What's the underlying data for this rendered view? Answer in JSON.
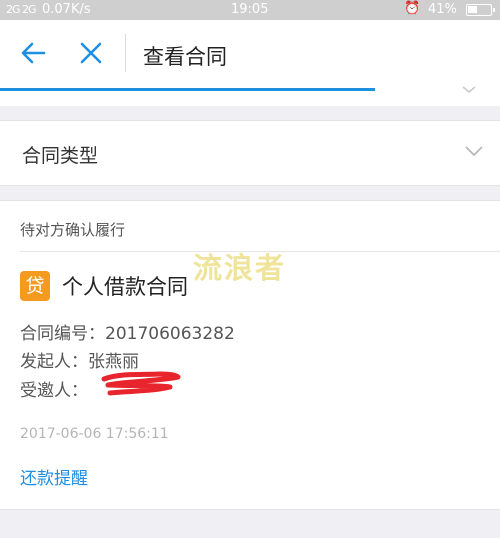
{
  "status_bar": {
    "signal": "2G 2G",
    "speed": "0.07K/s",
    "time": "19:05",
    "battery": "41%",
    "battery_level": 0.41
  },
  "nav": {
    "title": "查看合同"
  },
  "page_progress": 0.75,
  "contract_type": {
    "label": "合同类型"
  },
  "contract": {
    "status": "待对方确认履行",
    "watermark": "流浪者",
    "icon_char": "贷",
    "name": "个人借款合同",
    "number_line": "合同编号：201706063282",
    "initiator_line": "发起人：张燕丽",
    "invitee_label": "受邀人：",
    "timestamp": "2017-06-06 17:56:11",
    "remind_label": "还款提醒"
  },
  "colors": {
    "accent": "#1e8fe1",
    "icon_orange": "#f39a1f",
    "redaction": "#e8242c"
  }
}
